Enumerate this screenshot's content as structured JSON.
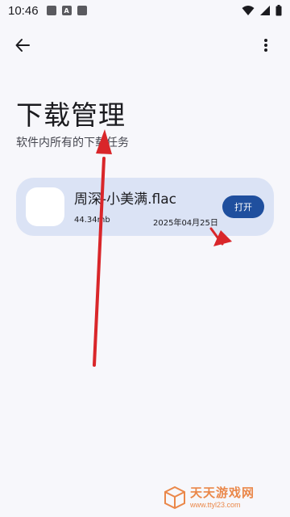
{
  "status_bar": {
    "time": "10:46",
    "notif_icons": [
      "app-icon",
      "a-badge-icon",
      "app-icon"
    ],
    "right_icons": [
      "wifi-icon",
      "signal-icon",
      "battery-icon"
    ]
  },
  "app_bar": {
    "back_icon": "arrow-left-icon",
    "menu_icon": "more-vert-icon"
  },
  "page": {
    "title": "下载管理",
    "subtitle": "软件内所有的下载任务"
  },
  "downloads": [
    {
      "name": "周深-小美满.flac",
      "size": "44.34mb",
      "date": "2025年04月25日",
      "action_label": "打开"
    }
  ],
  "notif_badge_letter": "A",
  "watermark": {
    "name": "天天游戏网",
    "url": "www.ttyl23.com"
  },
  "colors": {
    "background": "#f7f7fb",
    "card": "#dbe3f5",
    "primary_button": "#1f4f9e",
    "annotation_arrow": "#d9262a",
    "watermark": "#e8742a"
  }
}
